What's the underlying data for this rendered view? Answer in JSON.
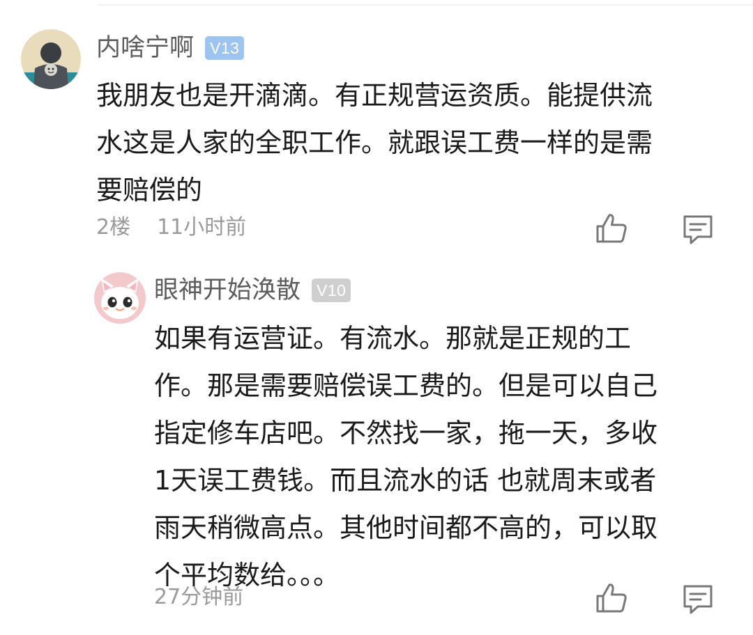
{
  "comments": [
    {
      "username": "内啥宁啊",
      "level": "V13",
      "text": "我朋友也是开滴滴。有正规营运资质。能提供流\n水这是人家的全职工作。就跟误工费一样的是需\n要赔偿的",
      "floor": "2楼",
      "time": "11小时前",
      "icons": {
        "like": "thumbs-up-icon",
        "reply": "comment-icon"
      },
      "badge_color": "#9dc4ef"
    },
    {
      "username": "眼神开始涣散",
      "level": "V10",
      "text": "如果有运营证。有流水。那就是正规的工\n作。那是需要赔偿误工费的。但是可以自己\n指定修车店吧。不然找一家，拖一天，多收\n1天误工费钱。而且流水的话 也就周末或者\n雨天稍微高点。其他时间都不高的，可以取\n个平均数给。。。",
      "time": "27分钟前",
      "icons": {
        "like": "thumbs-up-icon",
        "reply": "comment-icon"
      },
      "badge_color": "#cfcfcf"
    }
  ]
}
